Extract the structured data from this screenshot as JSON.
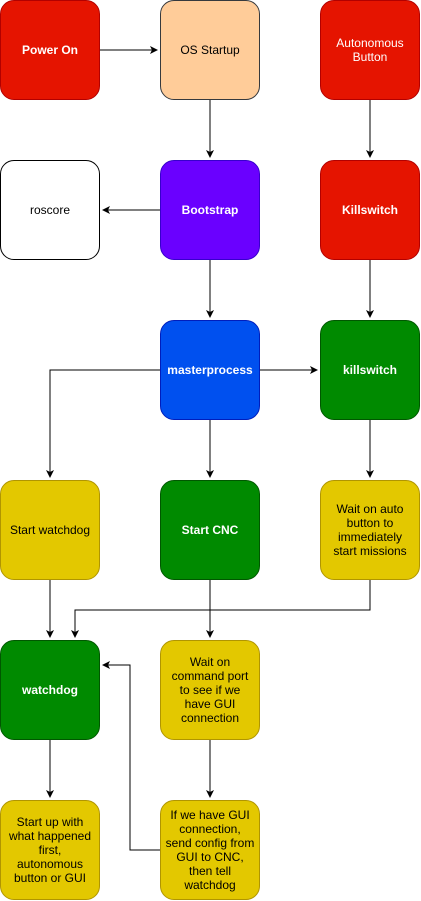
{
  "nodes": {
    "power_on": "Power On",
    "os_startup": "OS Startup",
    "autonomous_button": "Autonomous Button",
    "roscore": "roscore",
    "bootstrap": "Bootstrap",
    "killswitch_hw": "Killswitch",
    "masterprocess": "masterprocess",
    "killswitch_proc": "killswitch",
    "start_watchdog": "Start watchdog",
    "start_cnc": "Start CNC",
    "wait_auto": "Wait on auto button to immediately start missions",
    "watchdog": "watchdog",
    "wait_command": "Wait on command port to see if we have GUI connection",
    "startup_first": "Start up with what happened first, autonomous button or GUI",
    "gui_connection": "If we have GUI connection, send config from GUI to CNC, then tell watchdog"
  },
  "colors": {
    "red": "#e51400",
    "peach": "#ffcc99",
    "white": "#ffffff",
    "purple": "#6a00ff",
    "blue": "#0050ef",
    "green": "#008a00",
    "yellow": "#e3c800",
    "arrow": "#000000"
  }
}
